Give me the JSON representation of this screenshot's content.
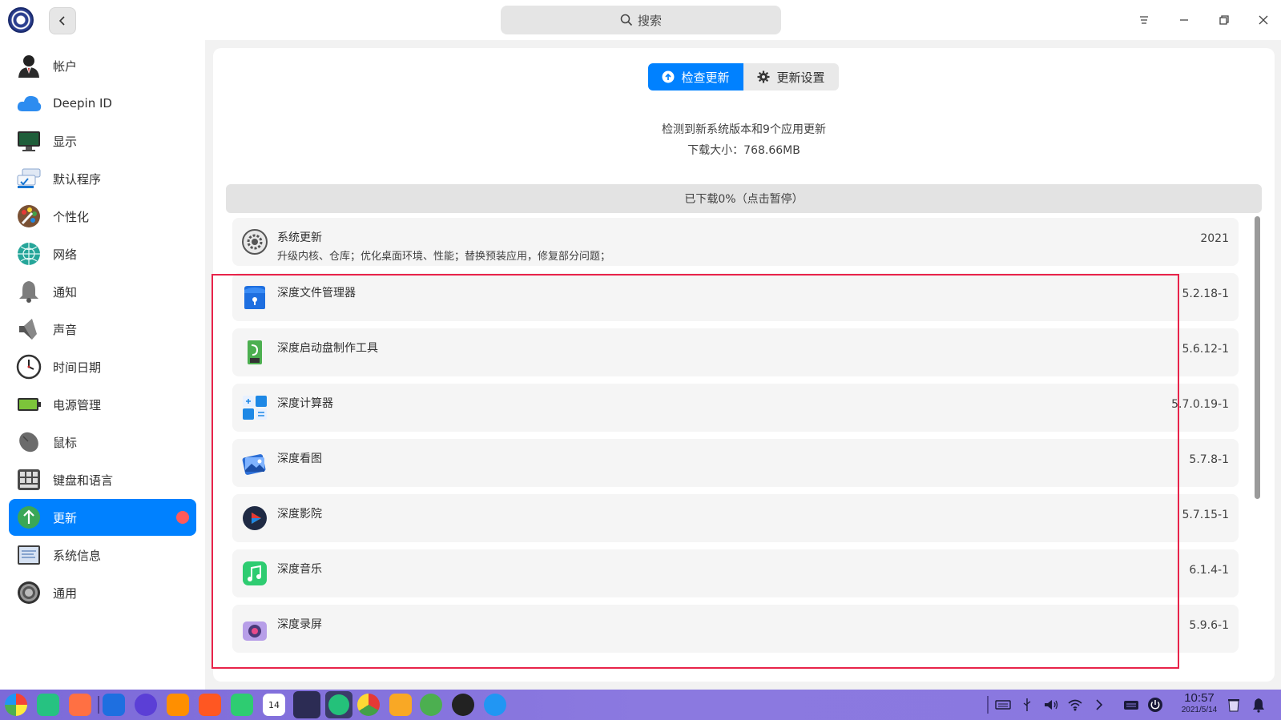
{
  "titlebar": {
    "search_placeholder": "搜索",
    "back_label": "‹"
  },
  "sidebar": {
    "items": [
      {
        "label": "帐户",
        "icon": "user-account-icon"
      },
      {
        "label": "Deepin ID",
        "icon": "cloud-icon"
      },
      {
        "label": "显示",
        "icon": "monitor-icon"
      },
      {
        "label": "默认程序",
        "icon": "default-apps-icon"
      },
      {
        "label": "个性化",
        "icon": "palette-icon"
      },
      {
        "label": "网络",
        "icon": "network-globe-icon"
      },
      {
        "label": "通知",
        "icon": "bell-icon"
      },
      {
        "label": "声音",
        "icon": "speaker-icon"
      },
      {
        "label": "时间日期",
        "icon": "clock-icon"
      },
      {
        "label": "电源管理",
        "icon": "battery-icon"
      },
      {
        "label": "鼠标",
        "icon": "mouse-icon"
      },
      {
        "label": "键盘和语言",
        "icon": "keyboard-icon"
      },
      {
        "label": "更新",
        "icon": "update-arrow-icon",
        "active": true
      },
      {
        "label": "系统信息",
        "icon": "system-info-icon"
      },
      {
        "label": "通用",
        "icon": "general-settings-icon"
      }
    ]
  },
  "main": {
    "tabs": [
      {
        "label": "检查更新",
        "icon": "upload-circle-icon",
        "active": true
      },
      {
        "label": "更新设置",
        "icon": "gear-icon",
        "active": false
      }
    ],
    "summary_line1": "检测到新系统版本和9个应用更新",
    "summary_line2": "下载大小：768.66MB",
    "progress_label": "已下载0%（点击暂停）",
    "progress_fraction": 0,
    "updates": [
      {
        "name": "系统更新",
        "description": "升级内核、仓库；优化桌面环境、性能；替换预装应用，修复部分问题；",
        "version": "2021",
        "icon": "system-update-gear-icon"
      },
      {
        "name": "深度文件管理器",
        "version": "5.2.18-1",
        "icon": "file-manager-icon"
      },
      {
        "name": "深度启动盘制作工具",
        "version": "5.6.12-1",
        "icon": "boot-maker-icon"
      },
      {
        "name": "深度计算器",
        "version": "5.7.0.19-1",
        "icon": "calculator-icon"
      },
      {
        "name": "深度看图",
        "version": "5.7.8-1",
        "icon": "image-viewer-icon"
      },
      {
        "name": "深度影院",
        "version": "5.7.15-1",
        "icon": "movie-player-icon"
      },
      {
        "name": "深度音乐",
        "version": "6.1.4-1",
        "icon": "music-icon"
      },
      {
        "name": "深度录屏",
        "version": "5.9.6-1",
        "icon": "screen-recorder-icon"
      }
    ]
  },
  "taskbar": {
    "clock_time": "10:57",
    "clock_date": "2021/5/14",
    "calendar_day": "14"
  },
  "colors": {
    "accent": "#0081ff",
    "badge": "#ff5a5a",
    "highlight_border": "#e8234a",
    "taskbar": "#8373dc"
  }
}
